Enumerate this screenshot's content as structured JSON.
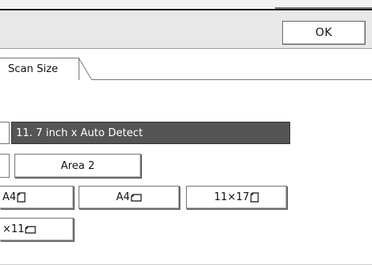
{
  "header": {
    "ok_label": "OK"
  },
  "tabs": [
    {
      "label": "Scan Size"
    }
  ],
  "selection": {
    "value": "11. 7 inch x Auto Detect"
  },
  "buttons": {
    "area2": "Area 2",
    "a4_portrait": "A4",
    "a4_landscape": "A4",
    "ledger": "11×17",
    "letter_partial": "×11"
  },
  "icons": {
    "portrait": "portrait-paper-icon",
    "landscape": "landscape-paper-icon"
  }
}
